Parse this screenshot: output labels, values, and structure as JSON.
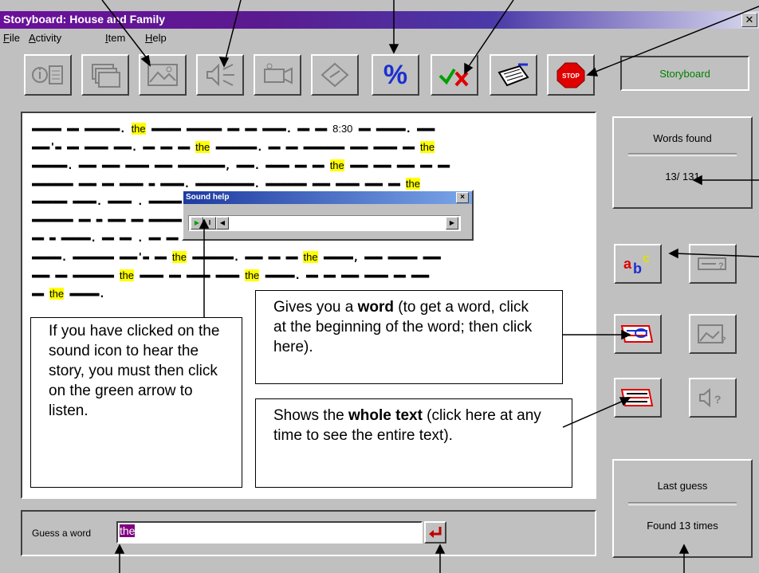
{
  "window": {
    "title": "Storyboard: House and Family",
    "close_label": "✕"
  },
  "menu": [
    {
      "label": "File",
      "accel": "F",
      "rest": "ile"
    },
    {
      "label": "Activity",
      "accel": "A",
      "rest": "ctivity"
    },
    {
      "label": "Item",
      "accel": "I",
      "rest": "tem"
    },
    {
      "label": "Help",
      "accel": "H",
      "rest": "elp"
    }
  ],
  "toolbar": {
    "buttons": [
      {
        "icon": "info-icon",
        "enabled": false
      },
      {
        "icon": "pages-icon",
        "enabled": false
      },
      {
        "icon": "picture-icon",
        "enabled": false
      },
      {
        "icon": "sound-icon",
        "enabled": false
      },
      {
        "icon": "video-icon",
        "enabled": false
      },
      {
        "icon": "tag-icon",
        "enabled": false
      },
      {
        "icon": "percent-icon",
        "enabled": true,
        "glyph": "%"
      },
      {
        "icon": "check-cross-icon",
        "enabled": true
      },
      {
        "icon": "notepad-icon",
        "enabled": true
      },
      {
        "icon": "stop-sign-icon",
        "enabled": true,
        "glyph": "STOP"
      }
    ],
    "mode_label": "Storyboard"
  },
  "text_panel": {
    "time": "8:30",
    "highlight_word": "the",
    "dot_leader": "."
  },
  "sound_help": {
    "title": "Sound help",
    "close_label": "×"
  },
  "callouts": {
    "sound": "If you have clicked on the sound icon to hear the story, you must then click on the green arrow to listen.",
    "word_pre": "Gives you a ",
    "word_bold": "word",
    "word_post": " (to get a word, click at the beginning of the word; then click here).",
    "text_pre": "Shows the ",
    "text_bold": "whole text",
    "text_post": " (click here at any time to see the entire text)."
  },
  "words_found": {
    "label": "Words found",
    "value": "13/ 131"
  },
  "last_guess": {
    "label": "Last guess",
    "value": "Found 13 times"
  },
  "guess": {
    "label": "Guess a word",
    "value": "the"
  },
  "side_buttons": [
    {
      "icon": "abc-icon",
      "enabled": true
    },
    {
      "icon": "hint-icon",
      "enabled": false
    },
    {
      "icon": "reveal-word-icon",
      "enabled": true
    },
    {
      "icon": "picture-hint-icon",
      "enabled": false
    },
    {
      "icon": "whole-text-icon",
      "enabled": true
    },
    {
      "icon": "sound-hint-icon",
      "enabled": false
    }
  ],
  "colors": {
    "title_purple": "#6b0f9a",
    "highlight": "#ffff00",
    "mode_green": "#008000",
    "selection": "#800080"
  }
}
